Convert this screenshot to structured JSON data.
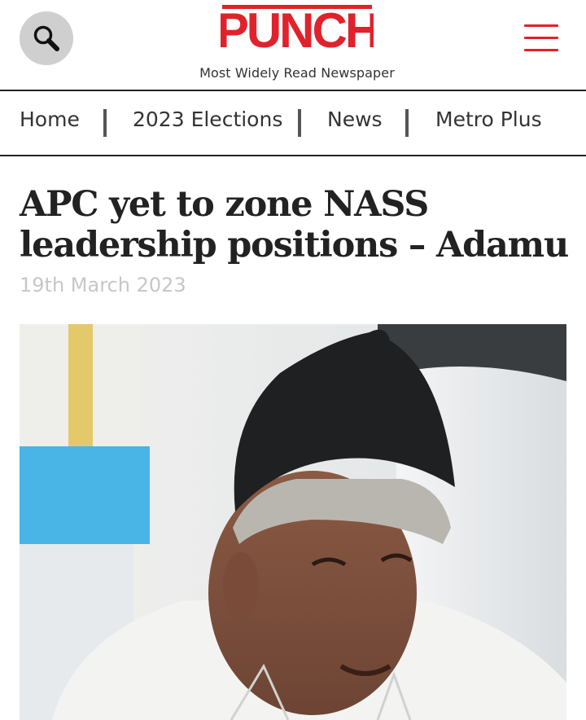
{
  "header": {
    "logo_text": "PUNCH",
    "tagline": "Most Widely Read Newspaper",
    "search_icon": "search-icon",
    "menu_icon": "hamburger-menu-icon",
    "brand_color": "#e0222c"
  },
  "nav": {
    "items": [
      {
        "label": "Home"
      },
      {
        "label": "2023 Elections"
      },
      {
        "label": "News"
      },
      {
        "label": "Metro Plus"
      }
    ]
  },
  "article": {
    "title": "APC yet to zone NASS leadership positions – Adamu",
    "date": "19th March 2023"
  }
}
